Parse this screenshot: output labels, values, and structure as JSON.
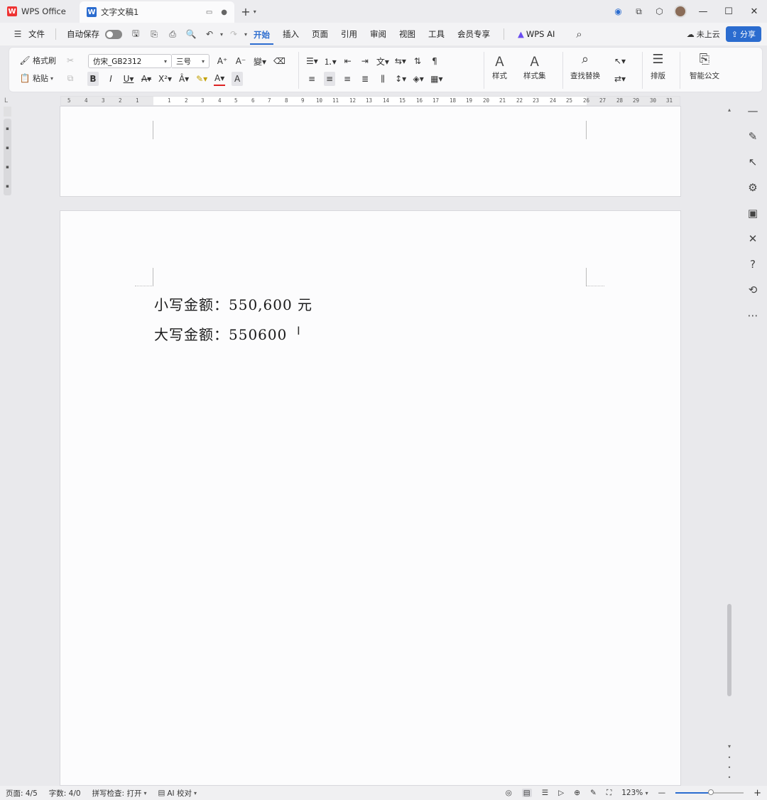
{
  "titlebar": {
    "home_tab": "WPS Office",
    "doc_tab": "文字文稿1",
    "new_tab": "+",
    "window_controls": [
      "—",
      "☐",
      "✕"
    ]
  },
  "menubar": {
    "file": "文件",
    "autosave": "自动保存",
    "tabs": [
      "开始",
      "插入",
      "页面",
      "引用",
      "审阅",
      "视图",
      "工具",
      "会员专享",
      "WPS AI"
    ],
    "active_tab": "开始",
    "cloud": "未上云",
    "share": "分享"
  },
  "ribbon": {
    "format_painter": "格式刷",
    "paste": "粘贴",
    "font_name": "仿宋_GB2312",
    "font_size": "三号",
    "styles": "样式",
    "style_set": "样式集",
    "find_replace": "查找替换",
    "layout": "排版",
    "smart_doc": "智能公文"
  },
  "ruler": {
    "ticks_left": [
      "5",
      "4",
      "3",
      "2",
      "1"
    ],
    "ticks_right": [
      "1",
      "2",
      "3",
      "4",
      "5",
      "6",
      "7",
      "8",
      "9",
      "10",
      "11",
      "12",
      "13",
      "14",
      "15",
      "16",
      "17",
      "18",
      "19",
      "20",
      "21",
      "22",
      "23",
      "24",
      "25",
      "26",
      "27",
      "28",
      "29",
      "30",
      "31"
    ]
  },
  "document": {
    "line1": "小写金额：550,600 元",
    "line2": "大写金额：550600"
  },
  "statusbar": {
    "page": "页面: 4/5",
    "words": "字数: 4/0",
    "spellcheck": "拼写检查: 打开",
    "ai_check": "AI 校对",
    "zoom": "123%",
    "zoom_level_fraction": 0.52
  }
}
